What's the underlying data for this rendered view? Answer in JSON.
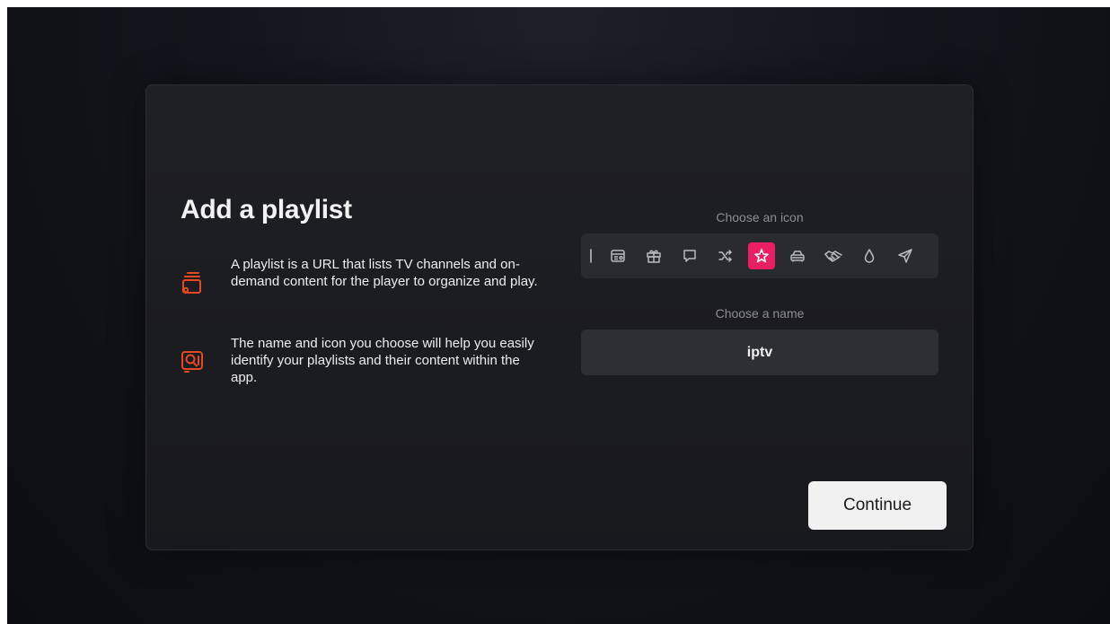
{
  "dialog": {
    "title": "Add a playlist",
    "info": [
      {
        "icon": "playlist-stack-icon",
        "text": "A playlist is a URL that lists TV channels and on-demand content for the player to organize and play."
      },
      {
        "icon": "search-list-icon",
        "text": "The name and icon you choose will help you easily identify your playlists and their content within the app."
      }
    ],
    "accent_color": "#e8481f",
    "icon_picker": {
      "label": "Choose an icon",
      "selected": "star-icon",
      "selected_color": "#e91e63",
      "icons": [
        "partial-icon",
        "radio-icon",
        "gift-icon",
        "chat-bubble-icon",
        "shuffle-icon",
        "star-icon",
        "car-icon",
        "handshake-icon",
        "water-drop-icon",
        "send-icon"
      ]
    },
    "name_picker": {
      "label": "Choose a name",
      "value": "iptv"
    },
    "continue_label": "Continue"
  }
}
